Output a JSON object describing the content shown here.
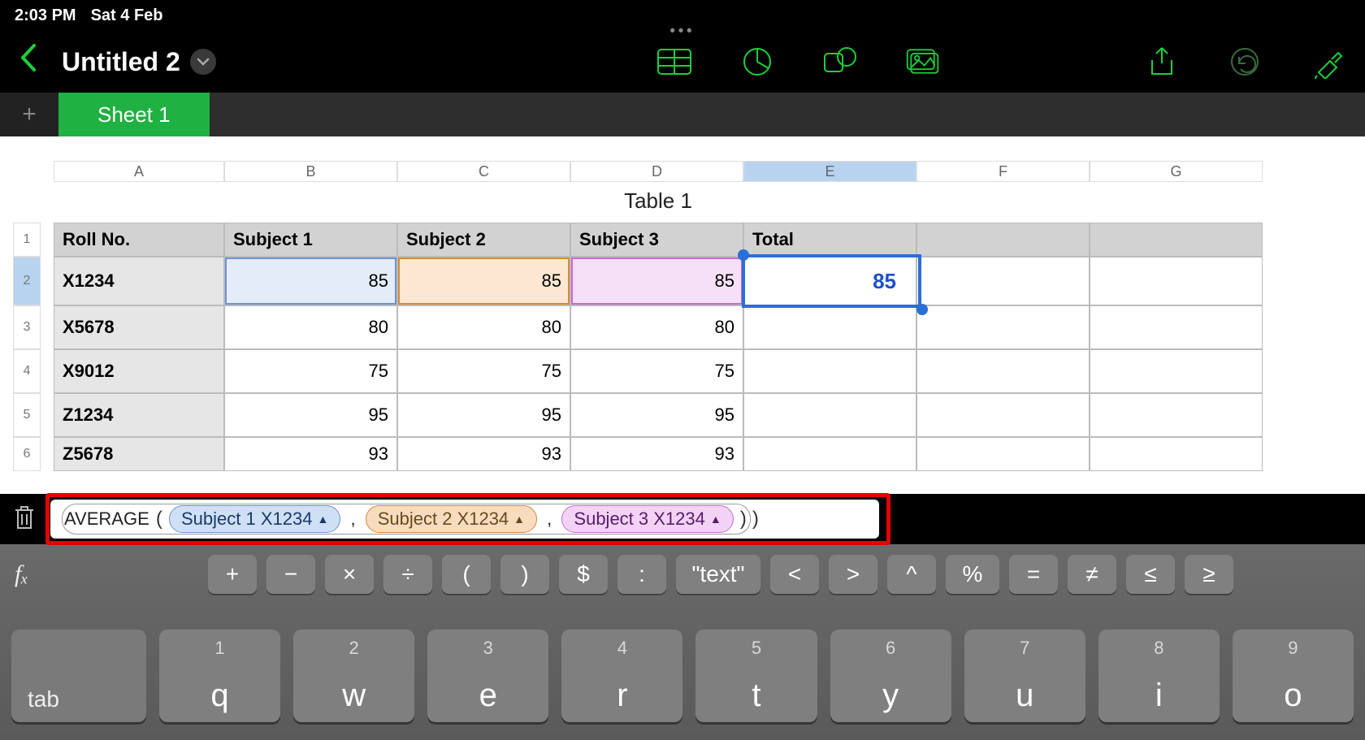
{
  "status": {
    "time": "2:03 PM",
    "date": "Sat 4 Feb"
  },
  "doc": {
    "title": "Untitled 2"
  },
  "sheet": {
    "name": "Sheet 1"
  },
  "columns": [
    "A",
    "B",
    "C",
    "D",
    "E",
    "F",
    "G"
  ],
  "table_title": "Table 1",
  "headers": {
    "rollno": "Roll No.",
    "s1": "Subject 1",
    "s2": "Subject 2",
    "s3": "Subject 3",
    "total": "Total"
  },
  "rows": [
    {
      "label": "X1234",
      "s1": "85",
      "s2": "85",
      "s3": "85",
      "total": "85"
    },
    {
      "label": "X5678",
      "s1": "80",
      "s2": "80",
      "s3": "80",
      "total": ""
    },
    {
      "label": "X9012",
      "s1": "75",
      "s2": "75",
      "s3": "75",
      "total": ""
    },
    {
      "label": "Z1234",
      "s1": "95",
      "s2": "95",
      "s3": "95",
      "total": ""
    },
    {
      "label": "Z5678",
      "s1": "93",
      "s2": "93",
      "s3": "93",
      "total": ""
    }
  ],
  "row_numbers": [
    "1",
    "2",
    "3",
    "4",
    "5",
    "6"
  ],
  "formula": {
    "fn": "AVERAGE",
    "t1": "Subject 1 X1234",
    "t2": "Subject 2 X1234",
    "t3": "Subject 3 X1234"
  },
  "ops": {
    "plus": "+",
    "minus": "−",
    "times": "×",
    "div": "÷",
    "lp": "(",
    "rp": ")",
    "dollar": "$",
    "colon": ":",
    "text": "\"text\"",
    "lt": "<",
    "gt": ">",
    "caret": "^",
    "pct": "%",
    "eq": "=",
    "neq": "≠",
    "le": "≤",
    "ge": "≥"
  },
  "keys": {
    "tab": "tab",
    "row": [
      {
        "d": "1",
        "l": "q"
      },
      {
        "d": "2",
        "l": "w"
      },
      {
        "d": "3",
        "l": "e"
      },
      {
        "d": "4",
        "l": "r"
      },
      {
        "d": "5",
        "l": "t"
      },
      {
        "d": "6",
        "l": "y"
      },
      {
        "d": "7",
        "l": "u"
      },
      {
        "d": "8",
        "l": "i"
      },
      {
        "d": "9",
        "l": "o"
      }
    ]
  },
  "fx_label": "fₓ"
}
